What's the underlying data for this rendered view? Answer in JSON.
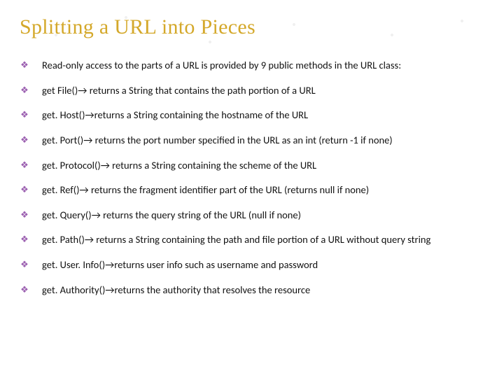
{
  "title": "Splitting a URL into Pieces",
  "bullet_glyph": "❖",
  "items": [
    {
      "html": "Read-only access to the parts of a URL is provided by 9 public methods in the URL class:"
    },
    {
      "html": "get File()→ returns a String that contains the path portion of a URL"
    },
    {
      "html": "get. Host()→returns a String containing the hostname of the URL"
    },
    {
      "html": "get. Port()→ returns the port number specified in the URL as an int (return -1 if none)"
    },
    {
      "html": "get. Protocol()→ returns a String containing the scheme of the URL"
    },
    {
      "html": "get. Ref()→ returns the fragment identifier part of the URL (returns null if none)"
    },
    {
      "html": "get. Query()→ returns the query string of the URL (null if none)"
    },
    {
      "html": "get. Path()→ returns a String containing the path and file portion of a URL without query string"
    },
    {
      "html": "get. User. Info()→returns user info such as username and password"
    },
    {
      "html": "get. Authority()→returns the authority that resolves the resource"
    }
  ]
}
